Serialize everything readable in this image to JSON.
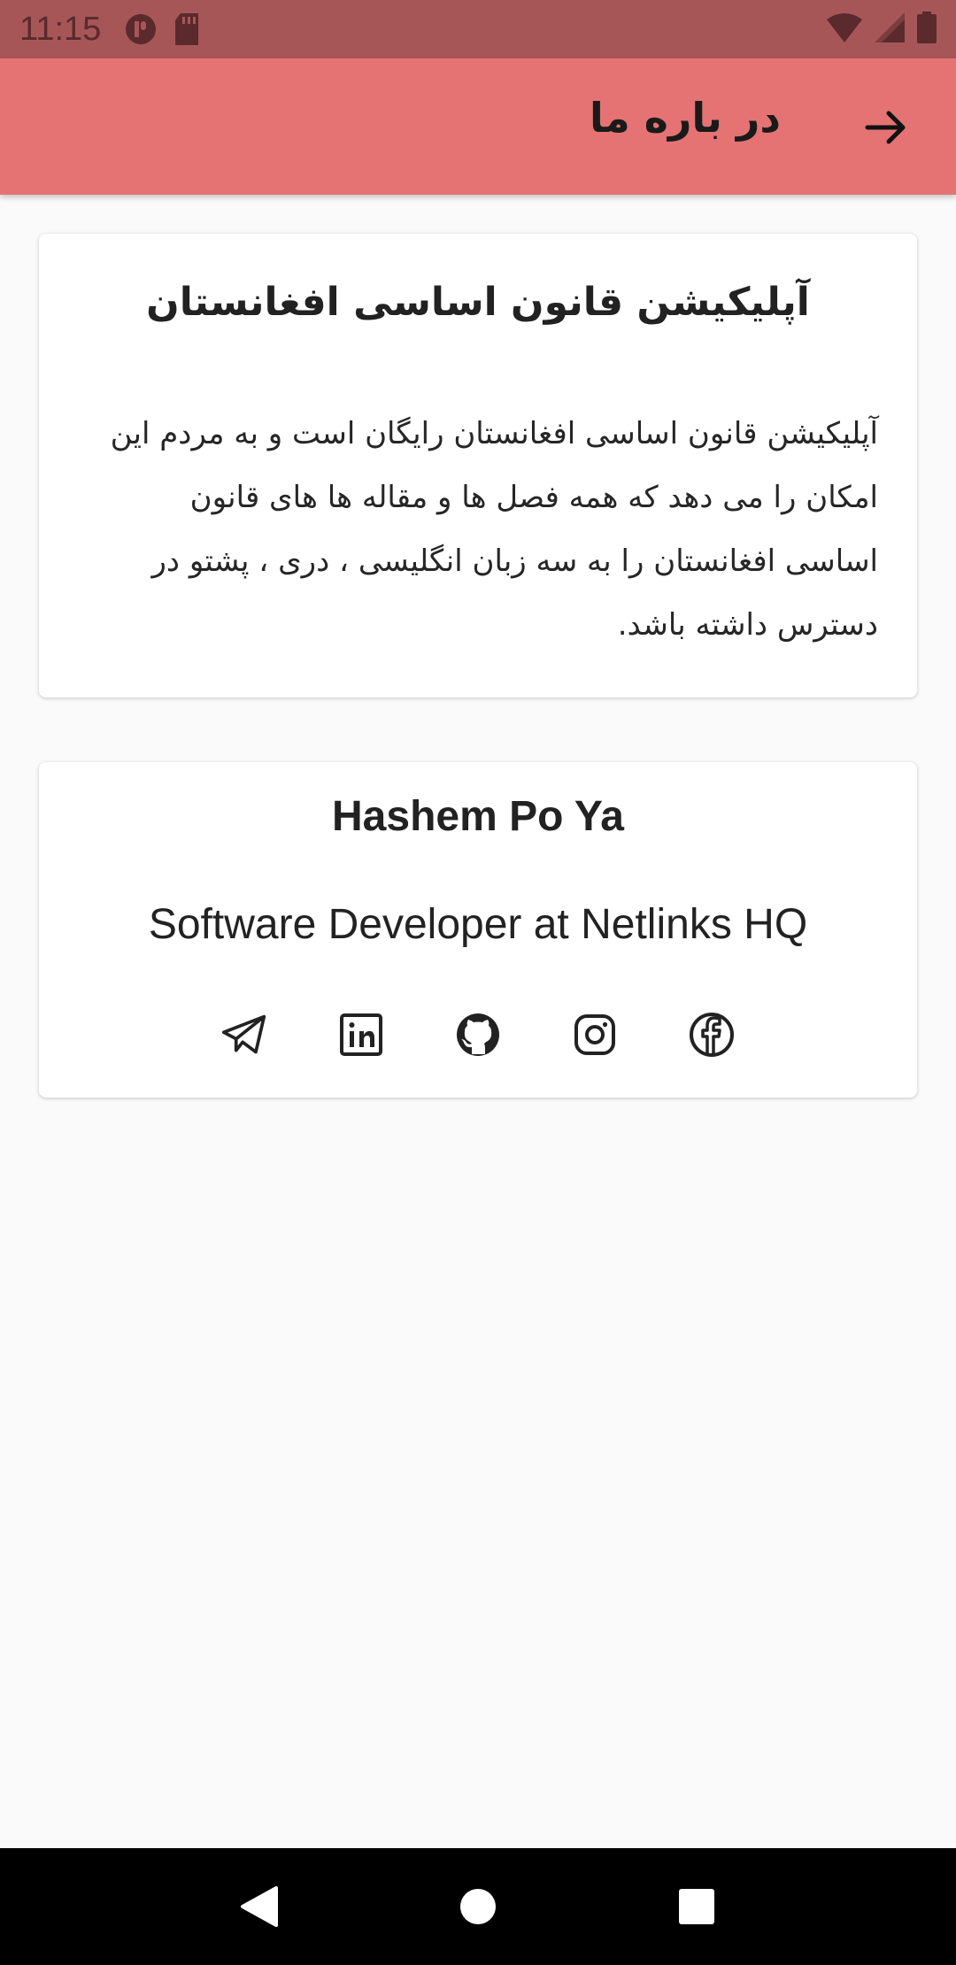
{
  "status_bar": {
    "time": "11:15"
  },
  "app_bar": {
    "title": "در باره ما",
    "back_icon": "arrow-forward-icon"
  },
  "about_card": {
    "title": "آپلیکیشن قانون اساسی افغانستان",
    "body": "آپلیکیشن قانون اساسی افغانستان رایگان است و به مردم این امکان را می دهد که همه فصل ها و مقاله ها های قانون اساسی افغانستان را به سه زبان انگلیسی ، دری ، پشتو در دسترس داشته باشد."
  },
  "developer_card": {
    "name": "Hashem Po Ya",
    "role": "Software Developer at Netlinks HQ",
    "social_icons": [
      "telegram-icon",
      "linkedin-icon",
      "github-icon",
      "instagram-icon",
      "facebook-icon"
    ]
  },
  "colors": {
    "app_bar": "#e57373",
    "status_bar": "#a75658",
    "background": "#fafafa",
    "card": "#ffffff",
    "nav_bar": "#000000"
  }
}
